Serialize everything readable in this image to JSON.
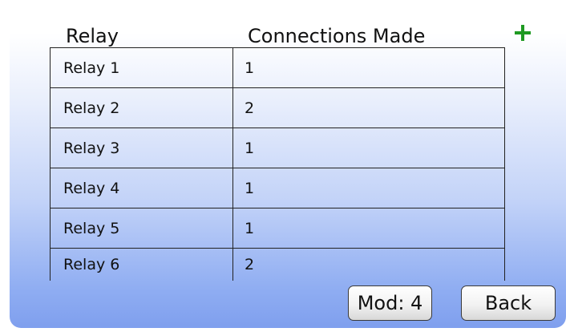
{
  "table": {
    "headers": {
      "relay": "Relay",
      "connections": "Connections Made"
    },
    "rows": [
      {
        "name": "Relay 1",
        "connections": "1"
      },
      {
        "name": "Relay 2",
        "connections": "2"
      },
      {
        "name": "Relay 3",
        "connections": "1"
      },
      {
        "name": "Relay 4",
        "connections": "1"
      },
      {
        "name": "Relay 5",
        "connections": "1"
      },
      {
        "name": "Relay 6",
        "connections": "2"
      }
    ]
  },
  "controls": {
    "add_icon": "plus-icon",
    "add_color": "#1f9a22",
    "mod_label": "Mod: 4",
    "back_label": "Back"
  },
  "colors": {
    "gradient_top": "#ffffff",
    "gradient_bottom": "#7f9fee"
  }
}
